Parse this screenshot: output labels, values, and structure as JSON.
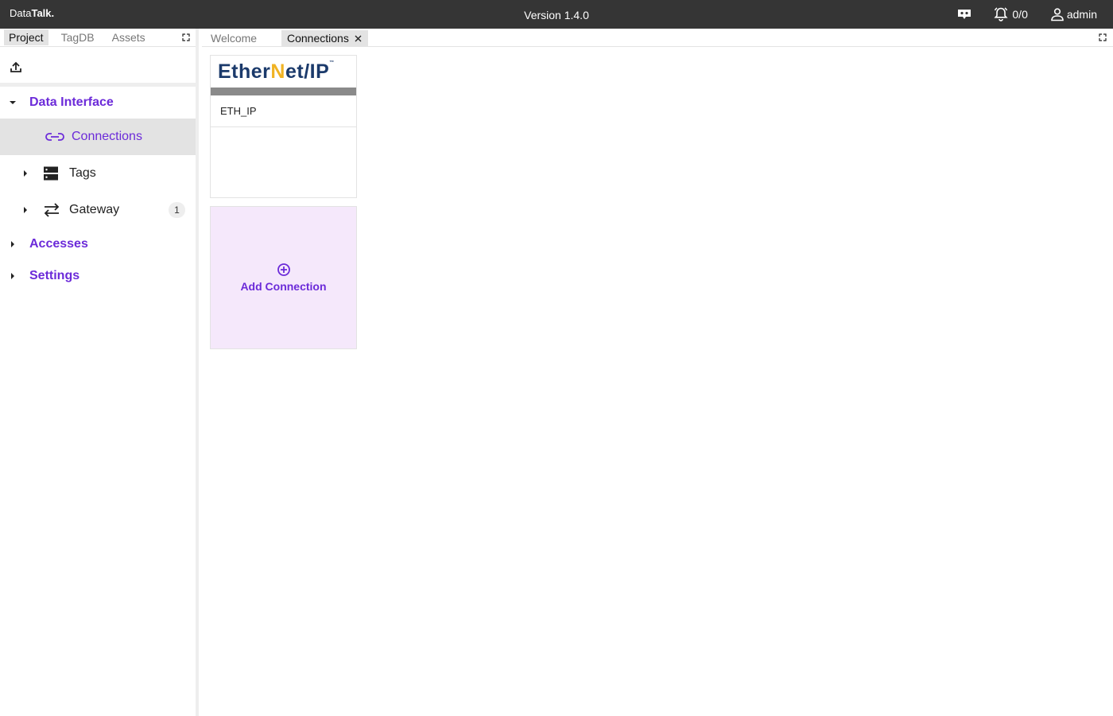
{
  "topbar": {
    "brand_regular": "Data",
    "brand_bold": "Talk.",
    "version": "Version 1.4.0",
    "alarm_count": "0/0",
    "user_name": "admin"
  },
  "left_panel": {
    "tabs": [
      {
        "label": "Project",
        "active": true
      },
      {
        "label": "TagDB",
        "active": false
      },
      {
        "label": "Assets",
        "active": false
      }
    ],
    "tree": {
      "data_interface": {
        "label": "Data Interface",
        "expanded": true,
        "children": {
          "connections": {
            "label": "Connections",
            "selected": true
          },
          "tags": {
            "label": "Tags"
          },
          "gateway": {
            "label": "Gateway",
            "badge": "1"
          }
        }
      },
      "accesses": {
        "label": "Accesses"
      },
      "settings": {
        "label": "Settings"
      }
    }
  },
  "main": {
    "tabs": [
      {
        "label": "Welcome",
        "active": false
      },
      {
        "label": "Connections",
        "active": true
      }
    ],
    "connection_card": {
      "logo_part1": "Ether",
      "logo_accent": "N",
      "logo_part2": "et/IP",
      "logo_tm": "™",
      "name": "ETH_IP"
    },
    "add_card": {
      "label": "Add Connection"
    }
  },
  "colors": {
    "topbar_bg": "#353535",
    "accent_purple": "#6c2bd9",
    "selected_bg": "#e3e3e3",
    "add_card_bg": "#f5e8fb",
    "logo_blue": "#1b3a6b",
    "logo_gold": "#f0b323"
  }
}
